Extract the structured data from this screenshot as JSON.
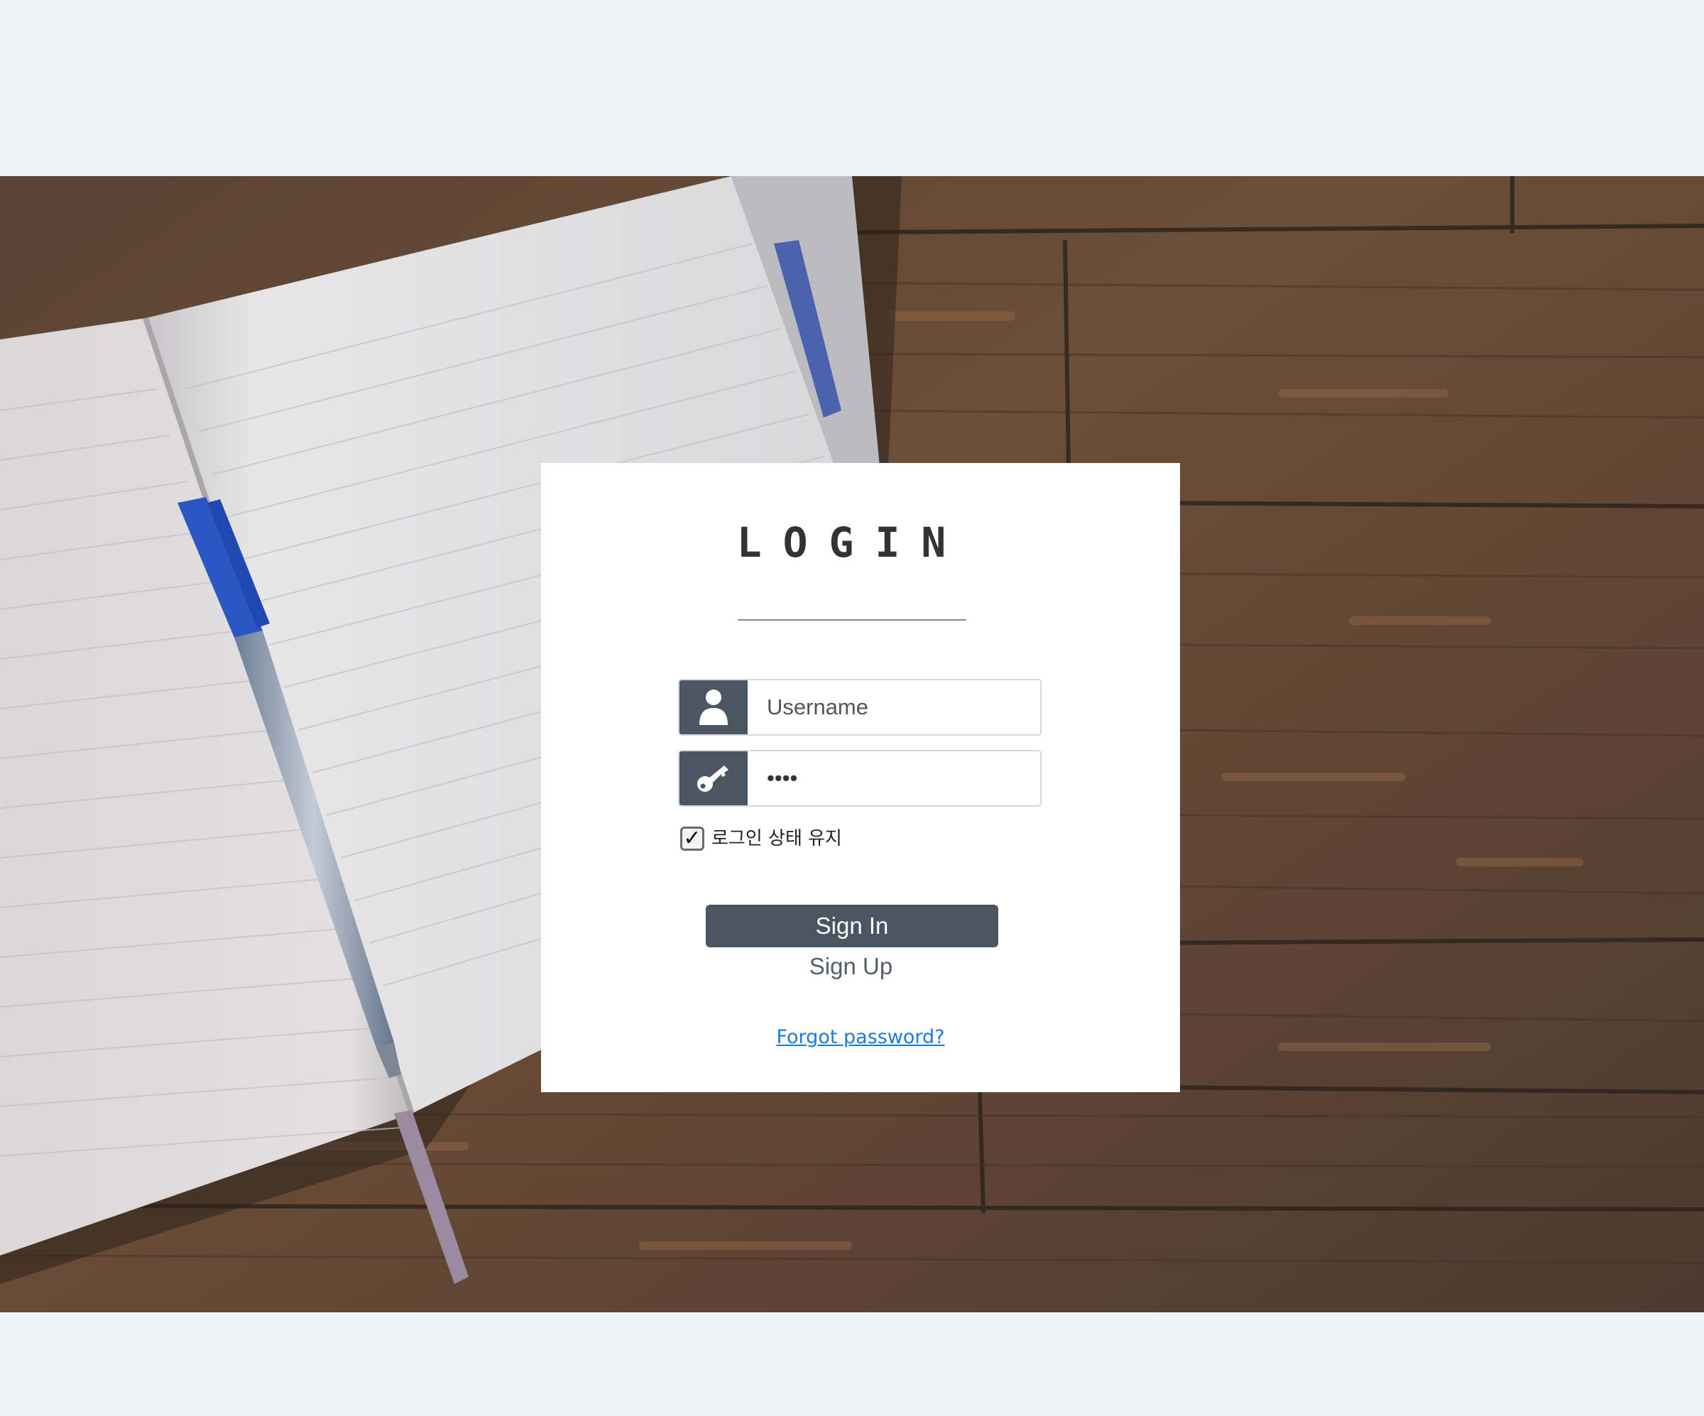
{
  "login": {
    "title": "LOGIN",
    "username": {
      "placeholder": "Username",
      "value": "",
      "icon": "user-icon"
    },
    "password": {
      "value": "aaaa",
      "icon": "key-icon"
    },
    "remember": {
      "label": "로그인 상태 유지",
      "checked": true
    },
    "signin_label": "Sign In",
    "signup_label": "Sign Up",
    "forgot_label": "Forgot password?"
  },
  "colors": {
    "page_background": "#eef3f7",
    "card_background": "#ffffff",
    "accent_dark": "#4a5661",
    "link": "#1a7bdc"
  }
}
